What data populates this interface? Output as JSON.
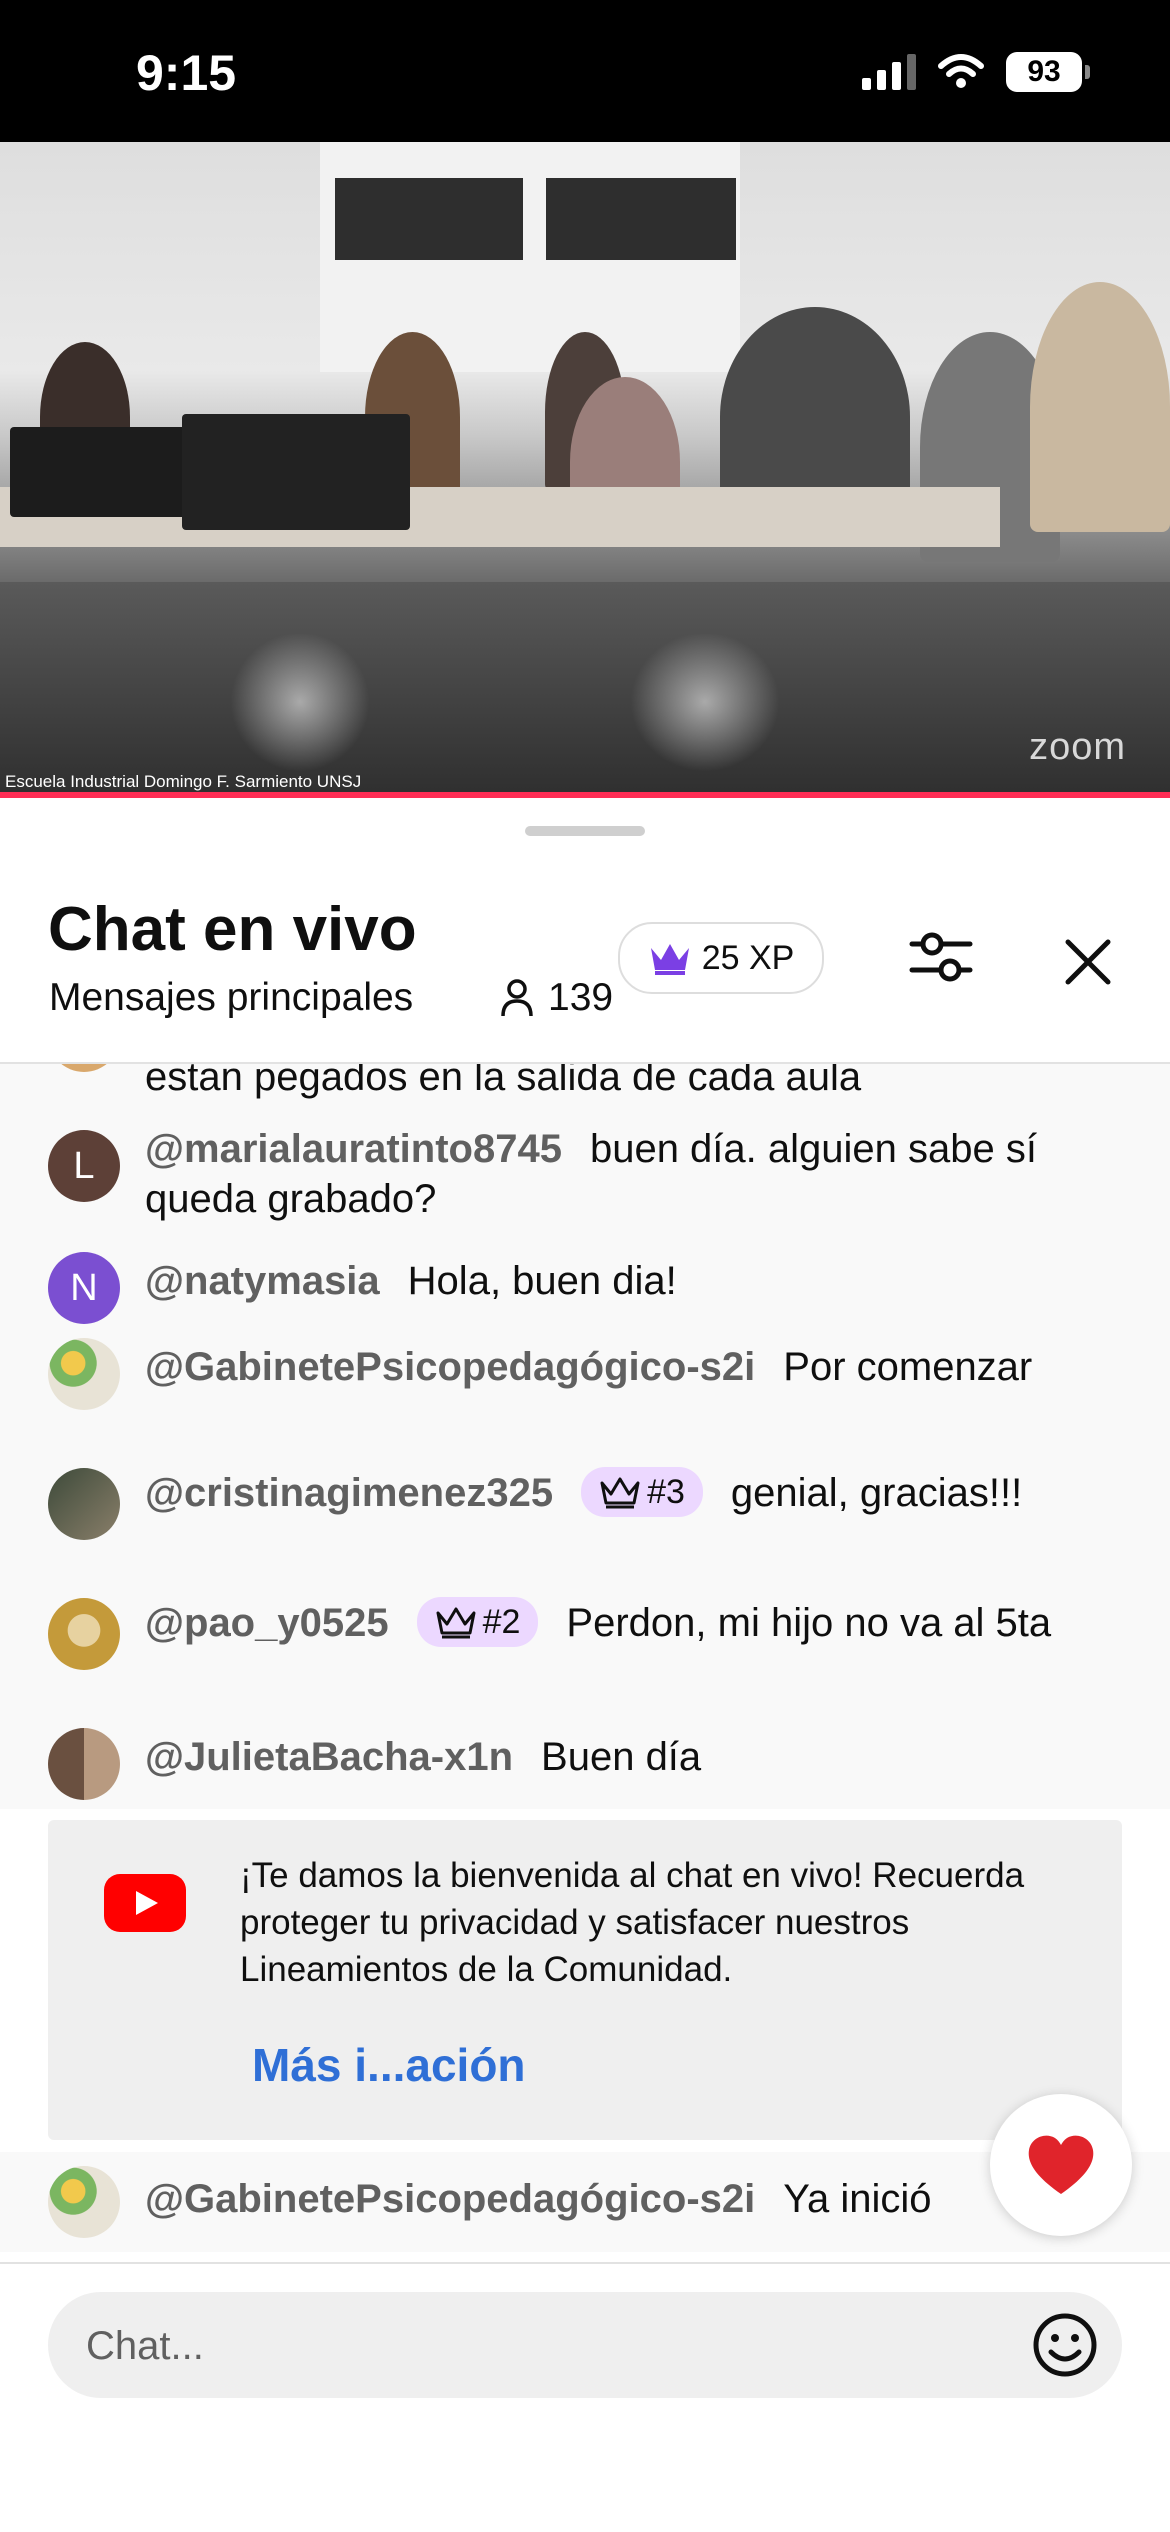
{
  "status_bar": {
    "time": "9:15",
    "battery": "93"
  },
  "video": {
    "caption": "Escuela Industrial Domingo F. Sarmiento UNSJ",
    "watermark": "zoom"
  },
  "header": {
    "title": "Chat en vivo",
    "subtitle": "Mensajes principales",
    "viewer_count": "139",
    "xp_label": "25 XP"
  },
  "messages": [
    {
      "author": "",
      "text": "estan pegados en la salida de cada aula",
      "avatar": "partial"
    },
    {
      "author": "@marialauratinto8745",
      "text": "buen día. alguien sabe sí queda grabado?",
      "avatar_letter": "L",
      "avatar_color": "#5d4037"
    },
    {
      "author": "@natymasia",
      "text": "Hola, buen dia!",
      "avatar_letter": "N",
      "avatar_color": "#7b4fd1"
    },
    {
      "author": "@GabinetePsicopedagógico-s2i",
      "text": "Por comenzar",
      "avatar": "image"
    },
    {
      "author": "@cristinagimenez325",
      "badge": "#3",
      "text": "genial, gracias!!!",
      "avatar": "image"
    },
    {
      "author": "@pao_y0525",
      "badge": "#2",
      "text": "Perdon, mi hijo no va al 5ta",
      "avatar": "image"
    },
    {
      "author": "@JulietaBacha-x1n",
      "text": "Buen día",
      "avatar": "image"
    }
  ],
  "welcome": {
    "text": "¡Te damos la bienvenida al chat en vivo! Recuerda proteger tu privacidad y satisfacer nuestros Lineamientos de la Comunidad.",
    "link": "Más i...ación"
  },
  "pinned": {
    "author": "@GabinetePsicopedagógico-s2i",
    "text": "Ya inició"
  },
  "input": {
    "placeholder": "Chat..."
  },
  "colors": {
    "badge_bg": "#ecd8ff",
    "link": "#2f6fd6",
    "youtube_red": "#ff0000",
    "accent_crown": "#7b3fe4"
  },
  "icons": [
    "signal-icon",
    "wifi-icon",
    "battery-icon",
    "crown-icon",
    "person-icon",
    "settings-sliders-icon",
    "close-icon",
    "youtube-icon",
    "heart-icon",
    "emoji-icon"
  ]
}
